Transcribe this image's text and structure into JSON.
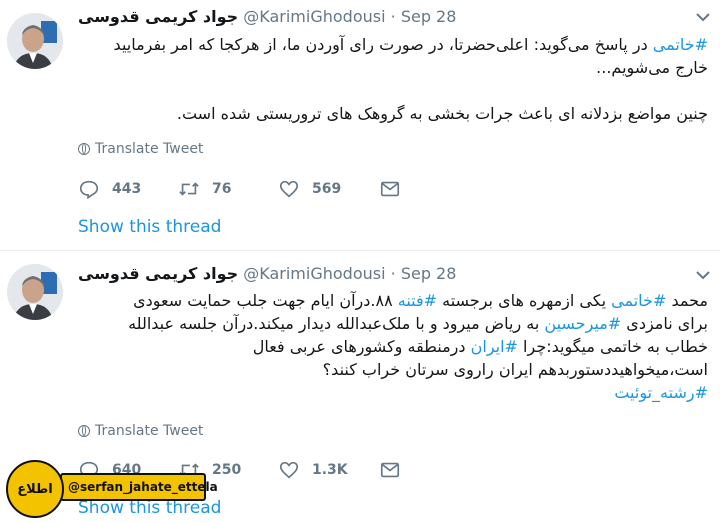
{
  "tweets": [
    {
      "name": "جواد کریمی قدوسی",
      "handle": "@KarimiGhodousi",
      "date": "Sep 28",
      "body_lines": [
        [
          {
            "t": "#خاتمی",
            "tag": true
          },
          {
            "t": " در پاسخ می‌گوید: اعلی‌حضرتا، در صورت رای آوردن ما، از هرکجا که امر بفرمایید",
            "tag": false
          }
        ],
        [
          {
            "t": "خارج می‌شویم...",
            "tag": false
          }
        ],
        [
          {
            "t": "",
            "tag": false
          }
        ],
        [
          {
            "t": "چنین مواضع بزدلانه ای باعث جرات بخشی به گروهک های تروریستی شده است.",
            "tag": false
          }
        ]
      ],
      "translate": "Translate Tweet",
      "replies": "443",
      "retweets": "76",
      "likes": "569",
      "thread": "Show this thread"
    },
    {
      "name": "جواد کریمی قدوسی",
      "handle": "@KarimiGhodousi",
      "date": "Sep 28",
      "body_lines": [
        [
          {
            "t": "محمد ",
            "tag": false
          },
          {
            "t": "#خاتمی",
            "tag": true
          },
          {
            "t": " یکی ازمهره های برجسته ",
            "tag": false
          },
          {
            "t": "#فتنه",
            "tag": true
          },
          {
            "t": " ۸۸.درآن ایام جهت جلب حمایت سعودی",
            "tag": false
          }
        ],
        [
          {
            "t": "برای نامزدی ",
            "tag": false
          },
          {
            "t": "#میرحسین",
            "tag": true
          },
          {
            "t": " به ریاض میرود و با ملک‌عبدالله دیدار میکند.درآن جلسه عبدالله",
            "tag": false
          }
        ],
        [
          {
            "t": "خطاب به خاتمی میگوید:چرا ",
            "tag": false
          },
          {
            "t": "#ایران",
            "tag": true
          },
          {
            "t": " درمنطقه وکشورهای عربی فعال",
            "tag": false
          }
        ],
        [
          {
            "t": "است،میخواهیددستوربدهم ایران راروی سرتان خراب کنند؟",
            "tag": false
          }
        ],
        [
          {
            "t": "#رشته_توئیت",
            "tag": true
          }
        ]
      ],
      "translate": "Translate Tweet",
      "replies": "640",
      "retweets": "250",
      "likes": "1.3K",
      "thread": "Show this thread"
    }
  ],
  "watermark": {
    "logo_text": "اطلاع",
    "handle": "@serfan_jahate_ettela"
  },
  "colors": {
    "link": "#1b95e0",
    "muted": "#657786",
    "text": "#14171a",
    "watermark": "#f4c300"
  }
}
